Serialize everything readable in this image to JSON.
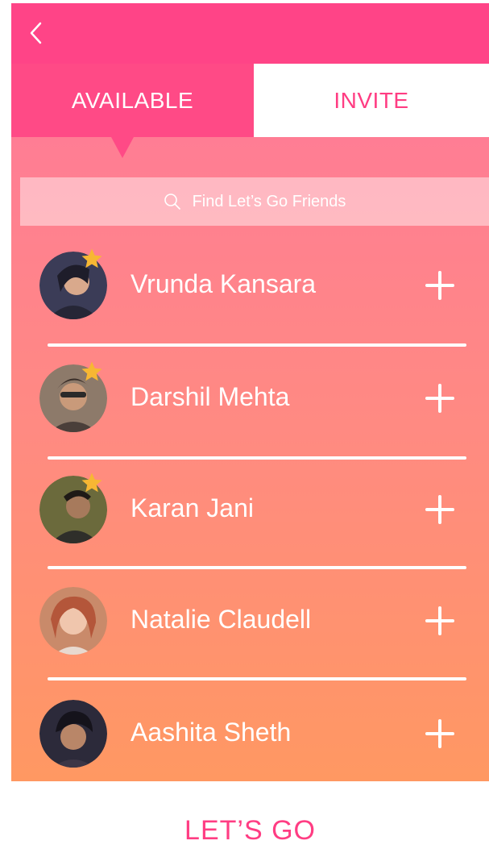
{
  "header": {
    "back_icon": "chevron-left-icon",
    "bar_color": "#ff4487"
  },
  "tabs": [
    {
      "label": "AVAILABLE",
      "selected": true
    },
    {
      "label": "INVITE",
      "selected": false
    }
  ],
  "search": {
    "placeholder": "Find Let’s Go Friends",
    "icon": "search-icon"
  },
  "friends": [
    {
      "name": "Vrunda Kansara",
      "starred": true,
      "avatar_color": "#3b3c57"
    },
    {
      "name": "Darshil Mehta",
      "starred": true,
      "avatar_color": "#8d7a6a"
    },
    {
      "name": "Karan Jani",
      "starred": true,
      "avatar_color": "#5a5a3a"
    },
    {
      "name": "Natalie Claudell",
      "starred": false,
      "avatar_color": "#c98a6a"
    },
    {
      "name": "Aashita Sheth",
      "starred": false,
      "avatar_color": "#2c2a3a"
    }
  ],
  "footer": {
    "cta_label": "LET’S GO"
  },
  "colors": {
    "accent": "#ff3d83",
    "gradient_top": "#ff7d94",
    "gradient_bottom": "#ff9862",
    "star": "#f7b733"
  }
}
